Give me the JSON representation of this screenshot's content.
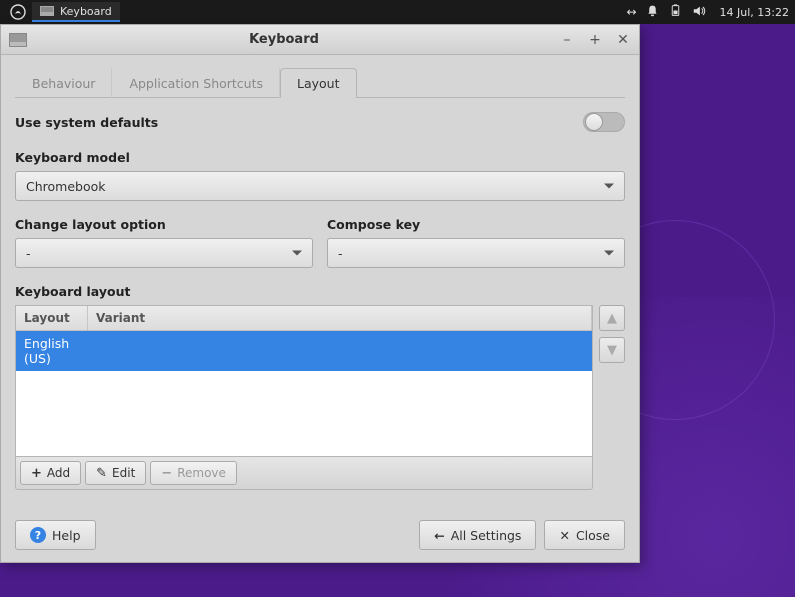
{
  "panel": {
    "task_title": "Keyboard",
    "clock": "14 Jul, 13:22"
  },
  "window": {
    "title": "Keyboard"
  },
  "tabs": {
    "behaviour": "Behaviour",
    "shortcuts": "Application Shortcuts",
    "layout": "Layout"
  },
  "settings": {
    "system_defaults_label": "Use system defaults",
    "keyboard_model_label": "Keyboard model",
    "keyboard_model_value": "Chromebook",
    "change_layout_label": "Change layout option",
    "change_layout_value": "-",
    "compose_key_label": "Compose key",
    "compose_key_value": "-",
    "keyboard_layout_section_label": "Keyboard layout"
  },
  "table": {
    "header_layout": "Layout",
    "header_variant": "Variant",
    "rows": [
      {
        "layout": "English (US)",
        "variant": ""
      }
    ]
  },
  "actions": {
    "add": "Add",
    "edit": "Edit",
    "remove": "Remove"
  },
  "footer": {
    "help": "Help",
    "all_settings": "All Settings",
    "close": "Close"
  }
}
